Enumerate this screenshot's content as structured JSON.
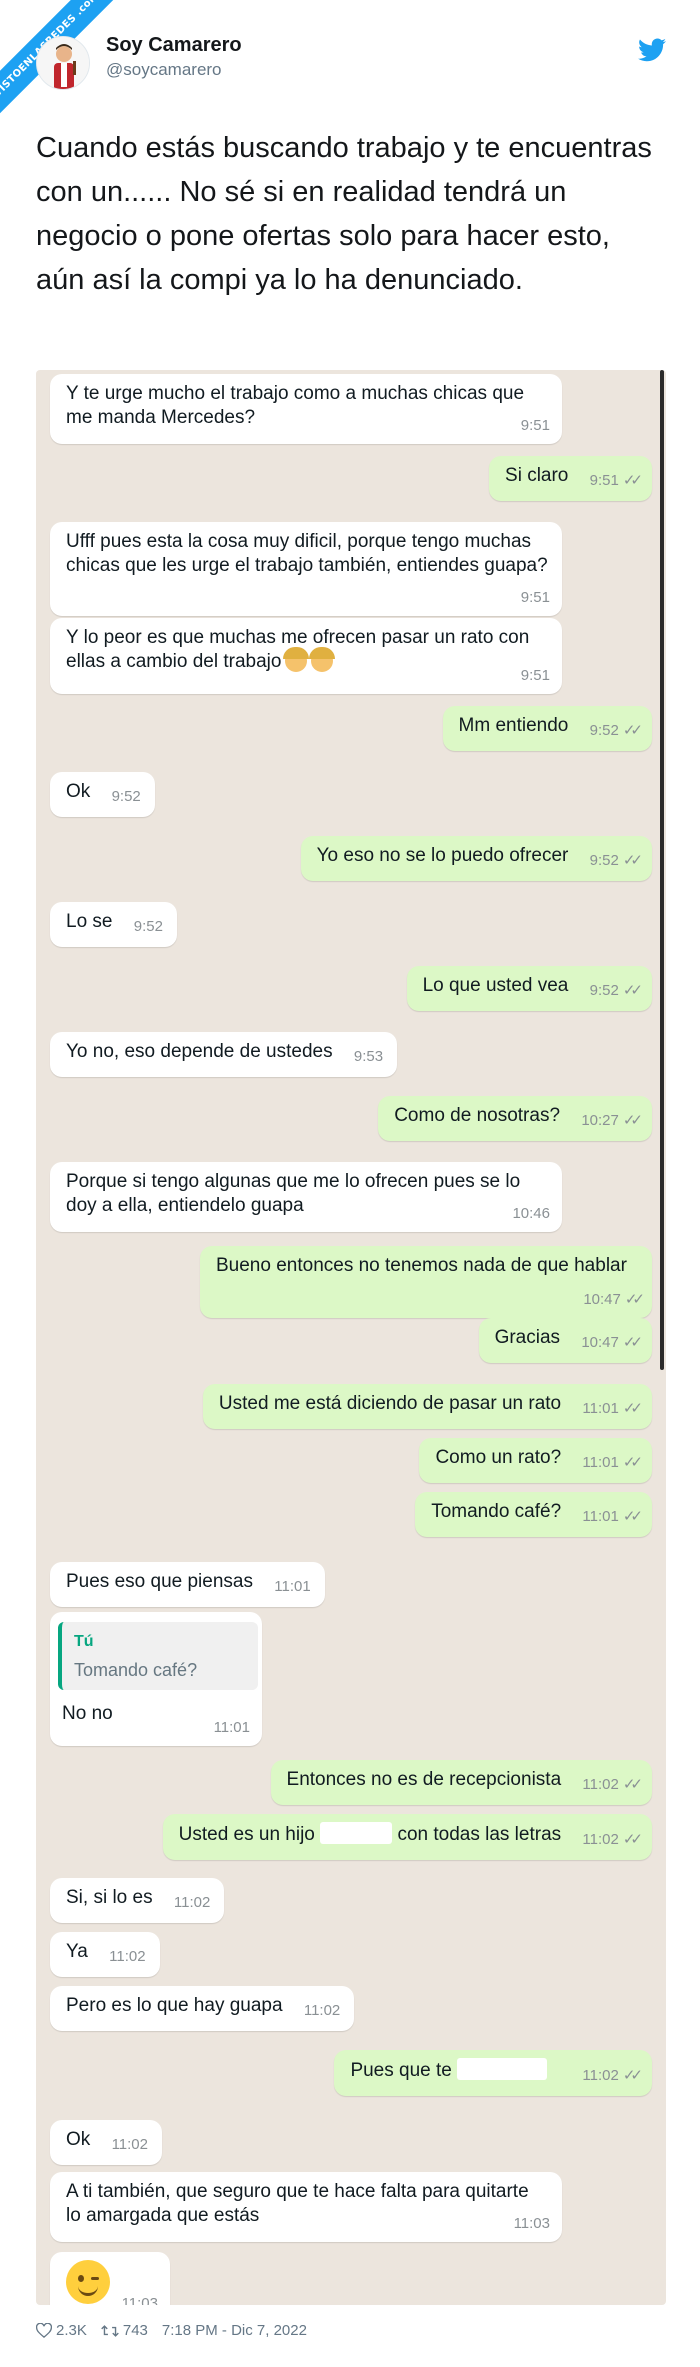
{
  "brand": {
    "ribbon_text": "VISTOENLASREDES .com",
    "accent": "#1da1f2"
  },
  "author": {
    "name": "Soy Camarero",
    "handle": "@soycamarero"
  },
  "icons": {
    "brand": "twitter-bird-icon",
    "like": "heart-icon",
    "retweet": "retweet-icon"
  },
  "tweet": {
    "text": "Cuando estás buscando trabajo y te encuentras con un...... No sé si en realidad tendrá un negocio o pone ofertas solo para hacer esto, aún así la compi ya lo ha denunciado."
  },
  "chat": {
    "bg": "#ece5dd",
    "incoming_bg": "#ffffff",
    "outgoing_bg": "#dcf8c6",
    "messages": [
      {
        "dir": "in",
        "text": "Y te urge mucho el trabajo como a muchas chicas que me manda Mercedes?",
        "time": "9:51"
      },
      {
        "dir": "out",
        "text": "Si claro",
        "time": "9:51"
      },
      {
        "dir": "in",
        "text": "Ufff pues esta la cosa muy dificil, porque tengo muchas chicas que les urge el trabajo también, entiendes guapa?",
        "time": "9:51"
      },
      {
        "dir": "in",
        "text": "Y lo peor es que muchas me ofrecen pasar un rato con ellas a cambio del trabajo",
        "time": "9:51"
      },
      {
        "dir": "out",
        "text": "Mm entiendo",
        "time": "9:52"
      },
      {
        "dir": "in",
        "text": "Ok",
        "time": "9:52"
      },
      {
        "dir": "out",
        "text": "Yo eso no se lo puedo ofrecer",
        "time": "9:52"
      },
      {
        "dir": "in",
        "text": "Lo se",
        "time": "9:52"
      },
      {
        "dir": "out",
        "text": "Lo que usted vea",
        "time": "9:52"
      },
      {
        "dir": "in",
        "text": "Yo no, eso depende de ustedes",
        "time": "9:53"
      },
      {
        "dir": "out",
        "text": "Como de nosotras?",
        "time": "10:27"
      },
      {
        "dir": "in",
        "text": "Porque si tengo algunas que me lo ofrecen pues se lo doy a ella, entiendelo guapa",
        "time": "10:46"
      },
      {
        "dir": "out",
        "text": "Bueno entonces no tenemos nada de que hablar",
        "time": "10:47"
      },
      {
        "dir": "out",
        "text": "Gracias",
        "time": "10:47"
      },
      {
        "dir": "out",
        "text": "Usted me está diciendo de pasar un rato",
        "time": "11:01"
      },
      {
        "dir": "out",
        "text": "Como un rato?",
        "time": "11:01"
      },
      {
        "dir": "out",
        "text": "Tomando café?",
        "time": "11:01"
      },
      {
        "dir": "in",
        "text": "Pues eso que piensas",
        "time": "11:01"
      },
      {
        "dir": "in",
        "quote_author": "Tú",
        "quote_text": "Tomando café?",
        "text": "No no",
        "time": "11:01"
      },
      {
        "dir": "out",
        "text": "Entonces no es de recepcionista",
        "time": "11:02"
      },
      {
        "dir": "out",
        "text_before": "Usted es un hijo",
        "text_after": "con todas las letras",
        "time": "11:02"
      },
      {
        "dir": "in",
        "text": "Si, si lo es",
        "time": "11:02"
      },
      {
        "dir": "in",
        "text": "Ya",
        "time": "11:02"
      },
      {
        "dir": "in",
        "text": "Pero es lo que hay guapa",
        "time": "11:02"
      },
      {
        "dir": "out",
        "text": "Pues que te",
        "time": "11:02"
      },
      {
        "dir": "in",
        "text": "Ok",
        "time": "11:02"
      },
      {
        "dir": "in",
        "text": "A ti también, que seguro que te hace falta para quitarte lo amargada que estás",
        "time": "11:03"
      },
      {
        "dir": "in",
        "emoji": "winking-face-emoji",
        "time": "11:03"
      }
    ]
  },
  "footer": {
    "likes": "2.3K",
    "retweets": "743",
    "timestamp": "7:18 PM - Dic 7, 2022"
  }
}
